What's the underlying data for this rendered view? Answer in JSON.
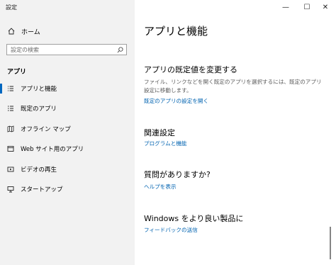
{
  "window": {
    "title": "設定"
  },
  "controls": {
    "minimize": "—",
    "maximize": "☐",
    "close": "✕"
  },
  "sidebar": {
    "home_label": "ホーム",
    "search_placeholder": "設定の検索",
    "section_header": "アプリ",
    "items": [
      {
        "label": "アプリと機能",
        "icon": "list-icon",
        "selected": true
      },
      {
        "label": "既定のアプリ",
        "icon": "default-apps-icon",
        "selected": false
      },
      {
        "label": "オフライン マップ",
        "icon": "map-icon",
        "selected": false
      },
      {
        "label": "Web サイト用のアプリ",
        "icon": "web-app-icon",
        "selected": false
      },
      {
        "label": "ビデオの再生",
        "icon": "video-icon",
        "selected": false
      },
      {
        "label": "スタートアップ",
        "icon": "startup-icon",
        "selected": false
      }
    ]
  },
  "main": {
    "title": "アプリと機能",
    "default_apps": {
      "heading": "アプリの既定値を変更する",
      "description": "ファイル、リンクなどを開く既定のアプリを選択するには、既定のアプリ設定に移動します。",
      "link": "既定のアプリの設定を開く"
    },
    "related": {
      "heading": "関連設定",
      "link": "プログラムと機能"
    },
    "questions": {
      "heading": "質問がありますか?",
      "link": "ヘルプを表示"
    },
    "better": {
      "heading": "Windows をより良い製品に",
      "link": "フィードバックの送信"
    }
  }
}
